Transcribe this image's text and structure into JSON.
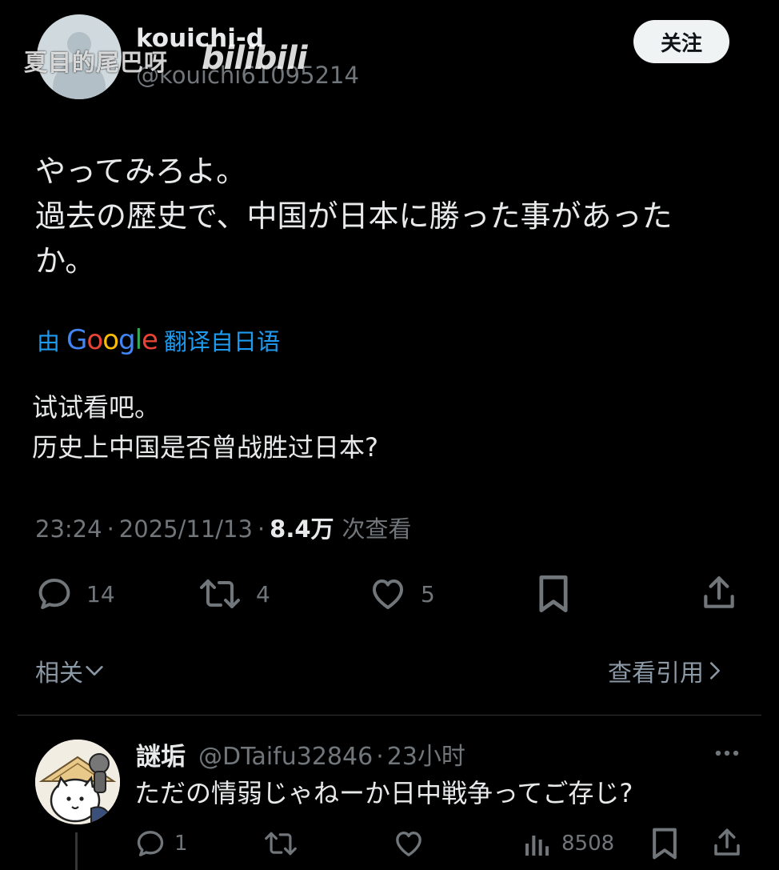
{
  "watermark": {
    "text": "夏目的尾巴呀",
    "logo": "bilibili"
  },
  "author": {
    "display_name": "kouichi-d",
    "handle": "@kouichi61095214"
  },
  "follow_button": "关注",
  "tweet": {
    "lines": [
      "やってみろよ。",
      "過去の歴史で、中国が日本に勝った事があった",
      "か。"
    ]
  },
  "translation": {
    "prefix": "由",
    "brand_letters": [
      "G",
      "o",
      "o",
      "g",
      "l",
      "e"
    ],
    "suffix": "翻译自日语",
    "lines": [
      "试试看吧。",
      "历史上中国是否曾战胜过日本?"
    ]
  },
  "meta": {
    "time": "23:24",
    "separator": "·",
    "date": "2025/11/13",
    "views": "8.4万",
    "views_label": "次查看"
  },
  "actions": {
    "replies": "14",
    "retweets": "4",
    "likes": "5"
  },
  "related": {
    "label": "相关",
    "view_quotes": "查看引用"
  },
  "reply": {
    "display_name": "謎垢",
    "handle": "@DTaifu32846",
    "separator": "·",
    "time": "23小时",
    "text": "ただの情弱じゃねーか日中戦争ってご存じ?",
    "actions": {
      "replies": "1",
      "views": "8508"
    }
  },
  "colors": {
    "background": "#000000",
    "text_primary": "#e7e9ea",
    "text_secondary": "#71767b",
    "link": "#1d9bf0",
    "follow_button_bg": "#eff3f4"
  }
}
